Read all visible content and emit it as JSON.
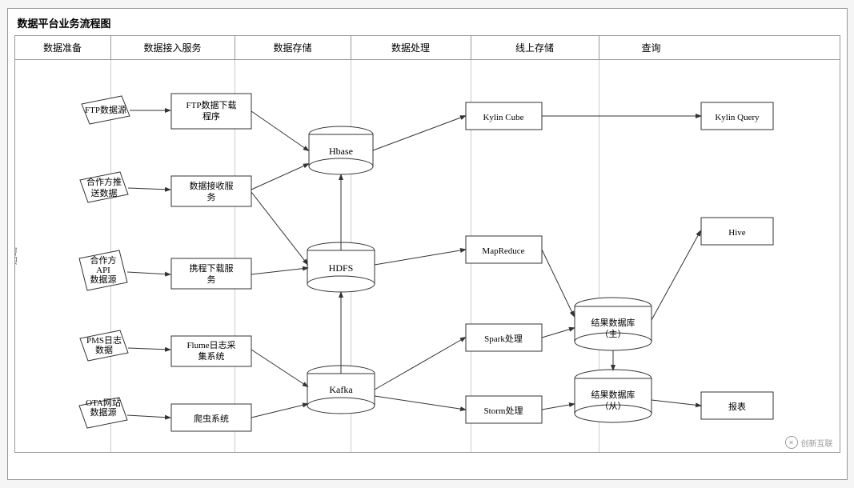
{
  "title": "数据平台业务流程图",
  "columns": [
    {
      "id": "col1",
      "label": "数据准备"
    },
    {
      "id": "col2",
      "label": "数据接入服务"
    },
    {
      "id": "col3",
      "label": "数据存储"
    },
    {
      "id": "col4",
      "label": "数据处理"
    },
    {
      "id": "col5",
      "label": "线上存储"
    },
    {
      "id": "col6",
      "label": "查询"
    }
  ],
  "nodes": {
    "ftp_source": "FTP数据源",
    "ftp_downloader": "FTP数据下载\n程序",
    "partner_push": "合作方推\n送数据",
    "data_receive": "数据接收服\n务",
    "partner_api": "合作方\nAPI\n数据源",
    "crawl_download": "携程下载服\n务",
    "pms_log": "PMS日志\n数据",
    "flume": "Flume日志采\n集系统",
    "ota_web": "OTA网站\n数据源",
    "crawler": "爬虫系统",
    "hbase": "Hbase",
    "hdfs": "HDFS",
    "kafka": "Kafka",
    "kylin_cube": "Kylin Cube",
    "mapreduce": "MapReduce",
    "spark": "Spark处理",
    "storm": "Storm处理",
    "result_master": "结果数据库\n（主）",
    "result_slave": "结果数据库\n（从）",
    "kylin_query": "Kylin Query",
    "hive": "Hive",
    "report": "报表"
  },
  "watermark": "创新互联",
  "left_label": "后端"
}
